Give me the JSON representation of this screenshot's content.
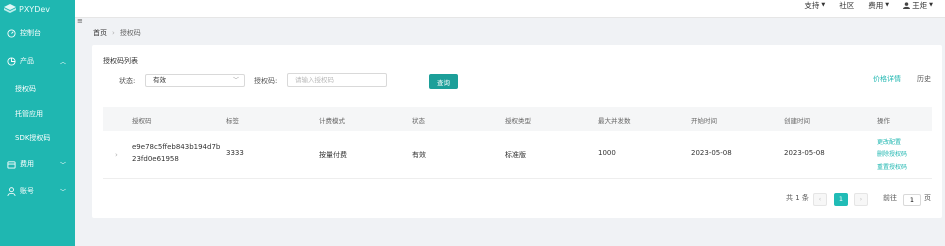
{
  "app": {
    "title": "PXYDev"
  },
  "top_nav": {
    "support": "支持",
    "community": "社区",
    "cost": "费用",
    "user": "王炬"
  },
  "sidebar": {
    "dashboard": "控制台",
    "product": "产品",
    "sub_items": [
      "授权码",
      "托管应用",
      "SDK授权码"
    ],
    "cost": "费用",
    "account": "账号"
  },
  "breadcrumb": {
    "home": "首页",
    "current": "授权码"
  },
  "panel": {
    "title": "授权码列表",
    "status_label": "状态:",
    "status_value": "有效",
    "code_label": "授权码:",
    "code_placeholder": "请输入授权码",
    "query_button": "查询",
    "price_link": "价格详情",
    "history_link": "历史"
  },
  "table": {
    "headers": [
      "授权码",
      "标签",
      "计费模式",
      "状态",
      "授权类型",
      "最大并发数",
      "开始时间",
      "创建时间",
      "操作"
    ],
    "rows": [
      {
        "code_line1": "e9e78c5ffeb843b194d7b",
        "code_line2": "23fd0e61958",
        "tag": "3333",
        "billing": "按量付费",
        "status": "有效",
        "type": "标准版",
        "max_concurrency": "1000",
        "start_time": "2023-05-08",
        "create_time": "2023-05-08",
        "actions": [
          "更改配置",
          "删除授权码",
          "重置授权码"
        ]
      }
    ]
  },
  "pagination": {
    "total": "共 1 条",
    "current_page": "1",
    "goto_label": "前往",
    "goto_value": "1",
    "page_suffix": "页"
  },
  "colors": {
    "accent": "#1fb7b1",
    "button": "#1c9f99",
    "background": "#f0f2f5"
  }
}
